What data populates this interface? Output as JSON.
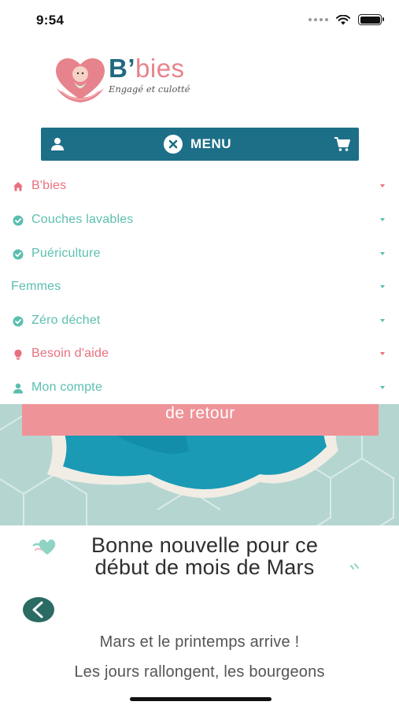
{
  "status_bar": {
    "time": "9:54"
  },
  "brand": {
    "name_prefix": "B",
    "name_apostrophe": "’",
    "name_suffix": "bies",
    "tagline": "Engagé et culotté",
    "colors": {
      "pink": "#e7838c",
      "teal": "#1f6a80"
    }
  },
  "menu_bar": {
    "label": "MENU",
    "background": "#1d6f88",
    "icons": [
      "user-icon",
      "close-icon",
      "cart-icon"
    ]
  },
  "nav": {
    "items": [
      {
        "label": "B'bies",
        "icon": "home-icon",
        "color": "#e8707e"
      },
      {
        "label": "Couches lavables",
        "icon": "check-circle-icon",
        "color": "#5bbfb0"
      },
      {
        "label": "Puériculture",
        "icon": "check-circle-icon",
        "color": "#5bbfb0"
      },
      {
        "label": "Femmes",
        "icon": "",
        "color": "#5bbfb0"
      },
      {
        "label": "Zéro déchet",
        "icon": "check-circle-icon",
        "color": "#5bbfb0"
      },
      {
        "label": "Besoin d'aide",
        "icon": "lightbulb-icon",
        "color": "#e8707e"
      },
      {
        "label": "Mon compte",
        "icon": "user-icon",
        "color": "#5bbfb0"
      }
    ]
  },
  "hero": {
    "cta_label": "de retour",
    "cta_color": "#ee9398"
  },
  "article": {
    "headline_line1": "Bonne nouvelle pour ce",
    "headline_line2": "début de mois de Mars",
    "body_line1": "Mars et le printemps arrive !",
    "body_line2": "Les jours rallongent, les bourgeons"
  }
}
